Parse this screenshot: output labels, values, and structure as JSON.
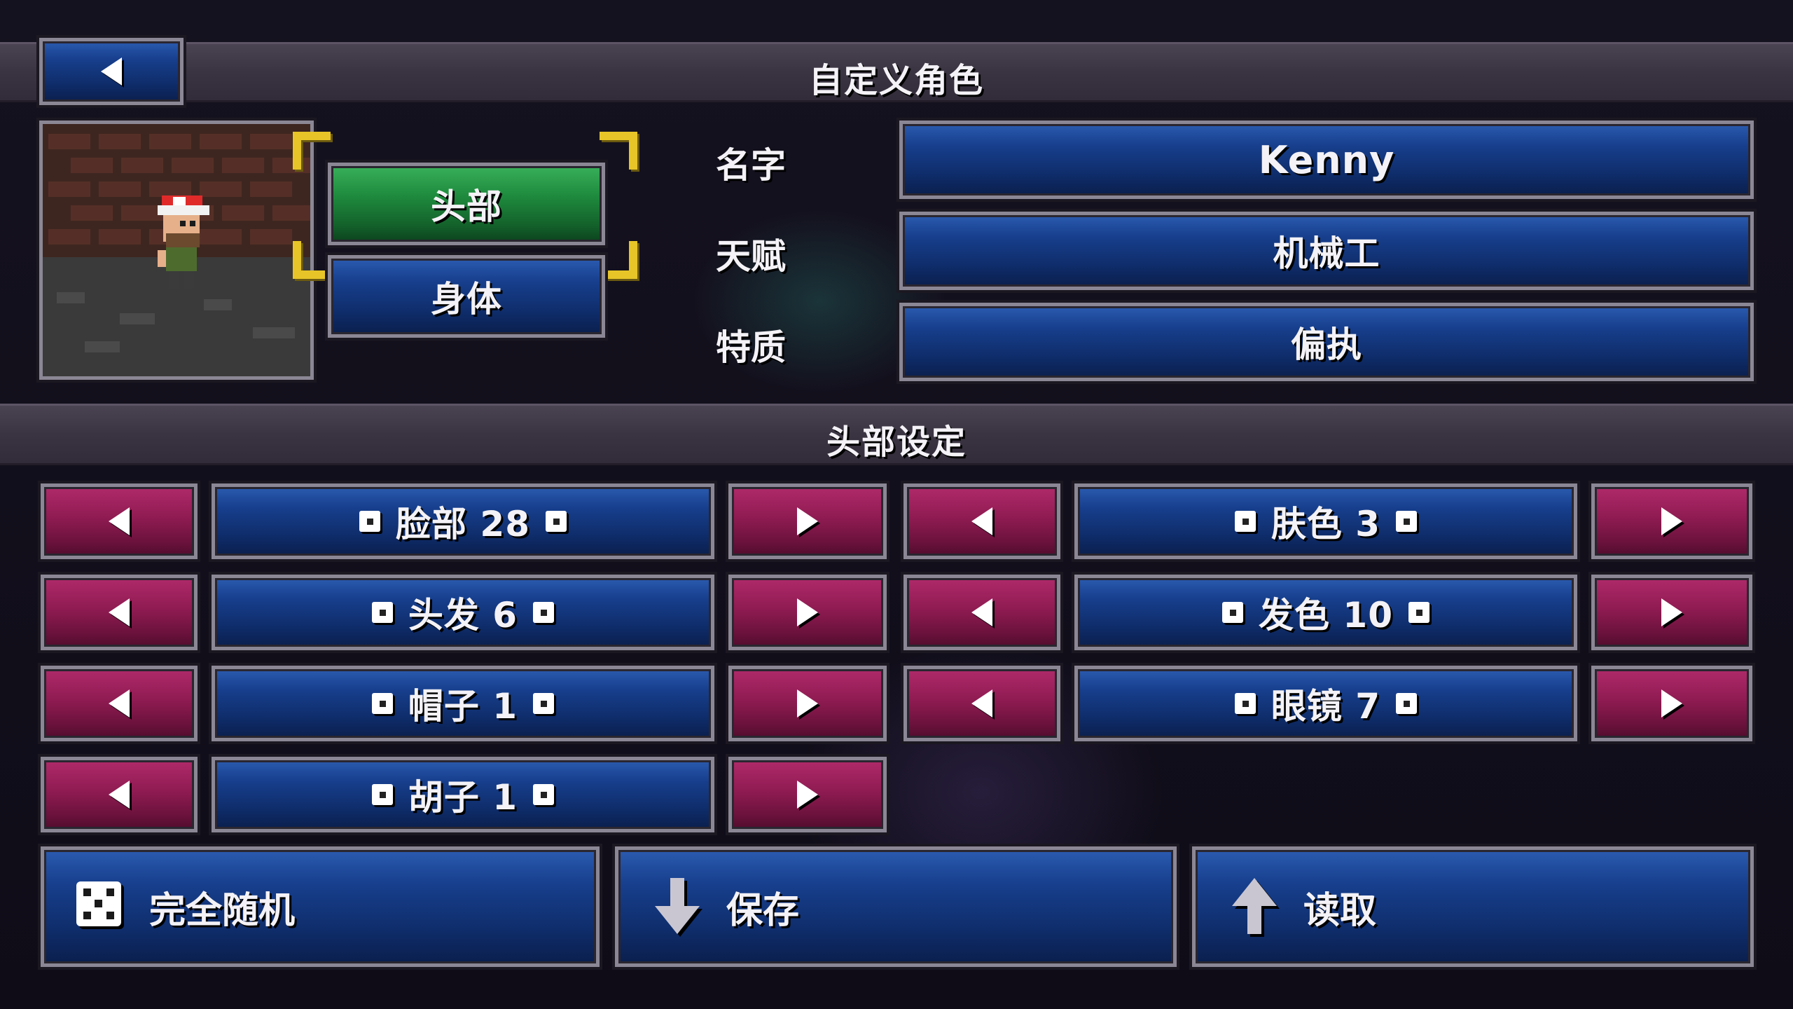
{
  "header": {
    "title": "自定义角色",
    "back_icon": "left-arrow-icon"
  },
  "part_tabs": [
    {
      "label": "头部",
      "selected": true,
      "color": "#1e8a3d"
    },
    {
      "label": "身体",
      "selected": false,
      "color": "#173f8d"
    }
  ],
  "fields": [
    {
      "label": "名字",
      "value": "Kenny"
    },
    {
      "label": "天赋",
      "value": "机械工"
    },
    {
      "label": "特质",
      "value": "偏执"
    }
  ],
  "section": {
    "title": "头部设定"
  },
  "head_settings": {
    "left": [
      {
        "label": "脸部 28"
      },
      {
        "label": "头发 6"
      },
      {
        "label": "帽子 1"
      },
      {
        "label": "胡子 1"
      }
    ],
    "right": [
      {
        "label": "肤色 3"
      },
      {
        "label": "发色 10"
      },
      {
        "label": "眼镜 7"
      }
    ]
  },
  "actions": [
    {
      "label": "完全随机",
      "icon": "dice-icon"
    },
    {
      "label": "保存",
      "icon": "down-arrow-icon"
    },
    {
      "label": "读取",
      "icon": "up-arrow-icon"
    }
  ],
  "colors": {
    "button_blue": "#173f8d",
    "button_magenta": "#8f1b52",
    "button_green": "#1e8a3d",
    "frame_gray": "#8c8794",
    "bracket_yellow": "#e7c528"
  }
}
